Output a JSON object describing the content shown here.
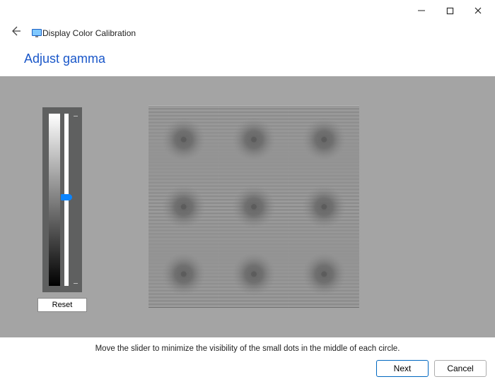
{
  "window": {
    "app_title": "Display Color Calibration"
  },
  "page": {
    "heading": "Adjust gamma",
    "instruction": "Move the slider to minimize the visibility of the small dots in the middle of each circle."
  },
  "slider": {
    "value_percent": 50
  },
  "buttons": {
    "reset": "Reset",
    "next": "Next",
    "cancel": "Cancel"
  },
  "colors": {
    "accent": "#0067c0",
    "heading": "#1a57c9",
    "content_bg": "#a4a4a4"
  }
}
